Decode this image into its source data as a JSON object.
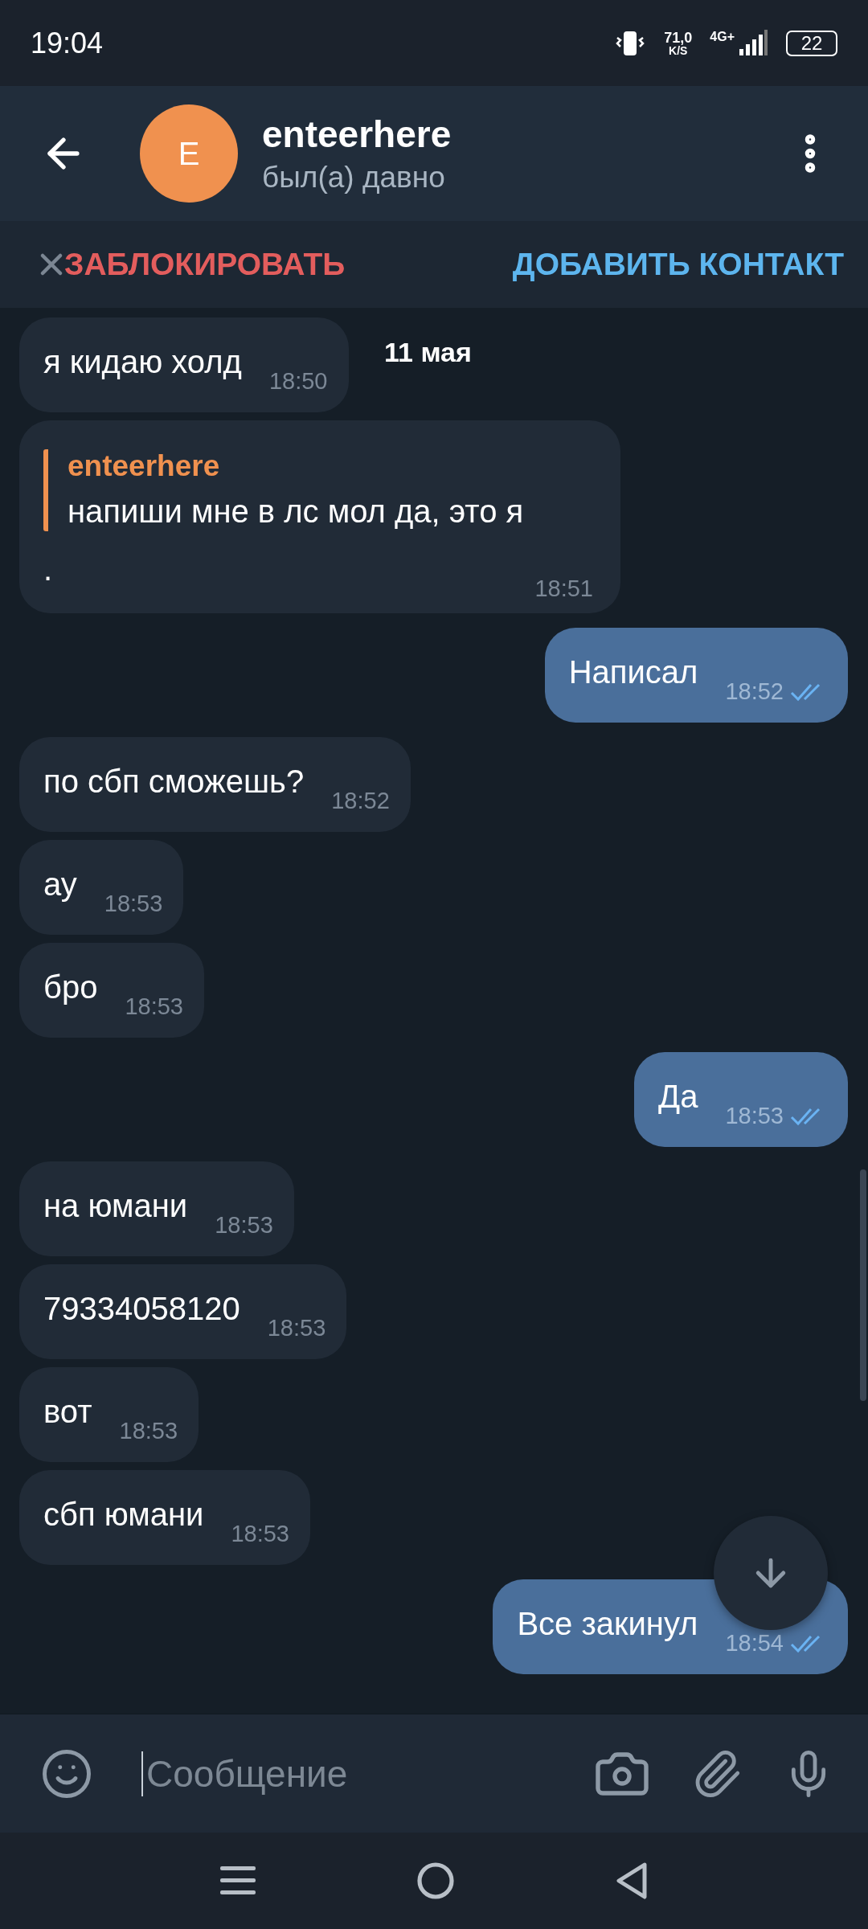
{
  "status_bar": {
    "time": "19:04",
    "speed": "71,0",
    "speed_unit": "K/S",
    "network": "4G+",
    "battery": "22"
  },
  "header": {
    "name": "enteerhere",
    "status": "был(а) давно",
    "avatar_letter": "E"
  },
  "action_bar": {
    "block": "ЗАБЛОКИРОВАТЬ",
    "add_contact": "ДОБАВИТЬ КОНТАКТ"
  },
  "date_chip": "11 мая",
  "messages": [
    {
      "kind": "incoming",
      "text": "я кидаю холд",
      "time": "18:50"
    },
    {
      "kind": "incoming",
      "quote": {
        "author": "enteerhere",
        "text": "напиши мне в лс мол да, это я"
      },
      "text": ".",
      "time": "18:51"
    },
    {
      "kind": "outgoing",
      "text": "Написал",
      "time": "18:52",
      "read": true
    },
    {
      "kind": "incoming",
      "text": "по сбп сможешь?",
      "time": "18:52"
    },
    {
      "kind": "incoming",
      "text": "ау",
      "time": "18:53"
    },
    {
      "kind": "incoming",
      "text": "бро",
      "time": "18:53"
    },
    {
      "kind": "outgoing",
      "text": "Да",
      "time": "18:53",
      "read": true
    },
    {
      "kind": "incoming",
      "text": "на юмани",
      "time": "18:53"
    },
    {
      "kind": "incoming",
      "text": "79334058120",
      "time": "18:53"
    },
    {
      "kind": "incoming",
      "text": "вот",
      "time": "18:53"
    },
    {
      "kind": "incoming",
      "text": "сбп юмани",
      "time": "18:53"
    },
    {
      "kind": "outgoing",
      "text": "Все закинул",
      "time": "18:54",
      "read": true
    }
  ],
  "composer": {
    "placeholder": "Сообщение"
  }
}
